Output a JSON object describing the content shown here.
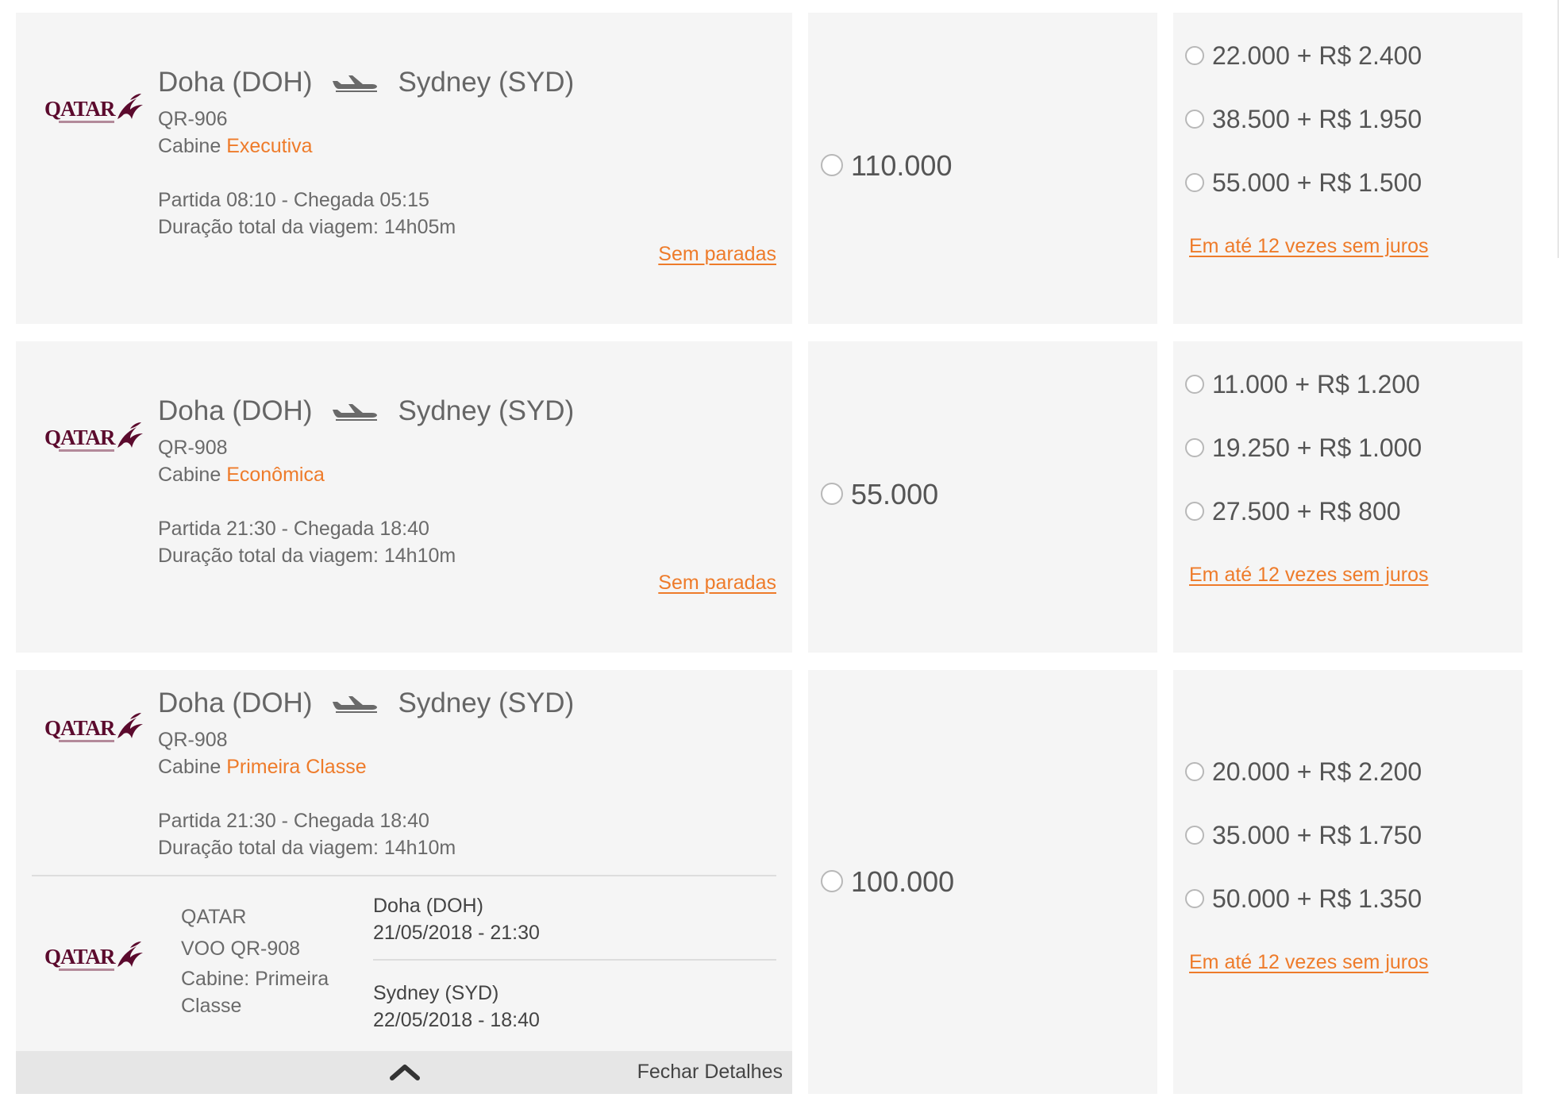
{
  "common": {
    "airline_logo": "QATAR",
    "plane_icon": "plane-landing-icon",
    "chevron_icon": "chevron-up-icon",
    "accent_color": "#ee7b2a",
    "brand_color": "#5b0a2d"
  },
  "flights": [
    {
      "origin": "Doha (DOH)",
      "destination": "Sydney (SYD)",
      "flight_no": "QR-906",
      "cabin_prefix": "Cabine",
      "cabin": "Executiva",
      "times": "Partida 08:10 - Chegada 05:15",
      "duration": "Duração total da viagem: 14h05m",
      "stops_link": "Sem paradas",
      "miles_option": "110.000",
      "combo_options": [
        "22.000 + R$ 2.400",
        "38.500 + R$ 1.950",
        "55.000 + R$ 1.500"
      ],
      "installments_link": "Em até 12 vezes sem juros"
    },
    {
      "origin": "Doha (DOH)",
      "destination": "Sydney (SYD)",
      "flight_no": "QR-908",
      "cabin_prefix": "Cabine",
      "cabin": "Econômica",
      "times": "Partida 21:30 - Chegada 18:40",
      "duration": "Duração total da viagem: 14h10m",
      "stops_link": "Sem paradas",
      "miles_option": "55.000",
      "combo_options": [
        "11.000 + R$ 1.200",
        "19.250 + R$ 1.000",
        "27.500 + R$ 800"
      ],
      "installments_link": "Em até 12 vezes sem juros"
    },
    {
      "origin": "Doha (DOH)",
      "destination": "Sydney (SYD)",
      "flight_no": "QR-908",
      "cabin_prefix": "Cabine",
      "cabin": "Primeira Classe",
      "times": "Partida 21:30 - Chegada 18:40",
      "duration": "Duração total da viagem: 14h10m",
      "miles_option": "100.000",
      "combo_options": [
        "20.000 + R$ 2.200",
        "35.000 + R$ 1.750",
        "50.000 + R$ 1.350"
      ],
      "installments_link": "Em até 12 vezes sem juros",
      "details": {
        "carrier": "QATAR",
        "flight": "VOO QR-908",
        "cabin": "Cabine: Primeira Classe",
        "departure_place": "Doha (DOH)",
        "departure_datetime": "21/05/2018 - 21:30",
        "arrival_place": "Sydney (SYD)",
        "arrival_datetime": "22/05/2018 - 18:40",
        "close_label": "Fechar Detalhes"
      }
    }
  ]
}
